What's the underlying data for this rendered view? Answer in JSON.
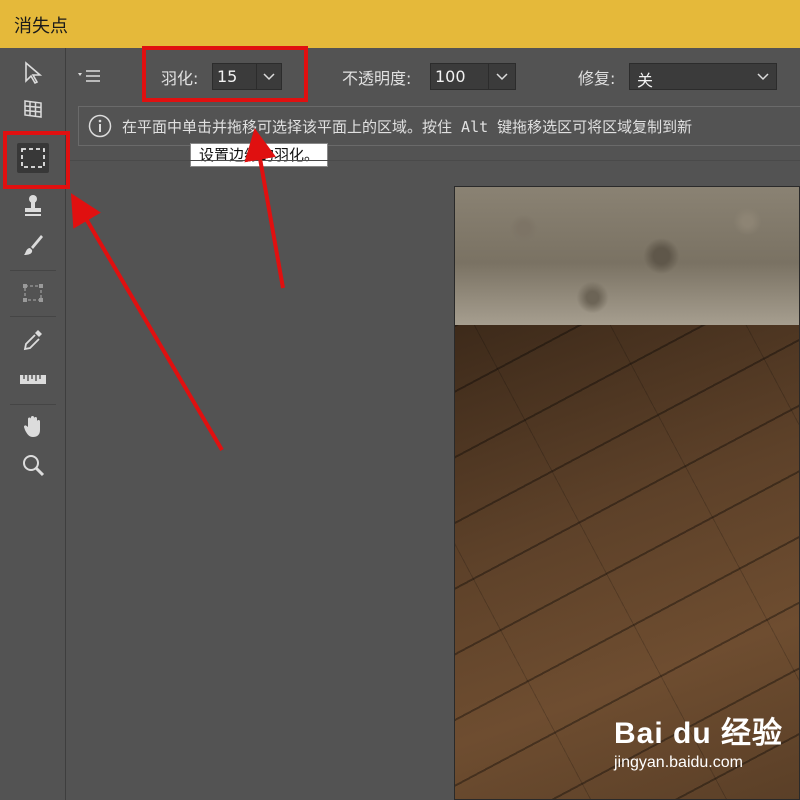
{
  "window": {
    "title": "消失点"
  },
  "options": {
    "feather_label": "羽化:",
    "feather_value": "15",
    "opacity_label": "不透明度:",
    "opacity_value": "100",
    "heal_label": "修复:",
    "heal_value": "关"
  },
  "info": {
    "message": "在平面中单击并拖移可选择该平面上的区域。按住 Alt 键拖移选区可将区域复制到新",
    "tooltip": "设置边缘的羽化。"
  },
  "toolbar": {
    "tools": [
      {
        "name": "edit-plane-tool",
        "icon": "arrow-icon"
      },
      {
        "name": "create-plane-tool",
        "icon": "grid-icon"
      },
      {
        "name": "marquee-tool",
        "icon": "marquee-icon",
        "active": true
      },
      {
        "name": "stamp-tool",
        "icon": "stamp-icon"
      },
      {
        "name": "brush-tool",
        "icon": "brush-icon"
      },
      {
        "name": "transform-tool",
        "icon": "transform-icon"
      },
      {
        "name": "eyedropper-tool",
        "icon": "eyedropper-icon"
      },
      {
        "name": "measure-tool",
        "icon": "ruler-icon"
      },
      {
        "name": "hand-tool",
        "icon": "hand-icon"
      },
      {
        "name": "zoom-tool",
        "icon": "zoom-icon"
      }
    ]
  },
  "watermark": {
    "logo": "Bai du 经验",
    "url": "jingyan.baidu.com"
  },
  "colors": {
    "titlebar": "#e5b93a",
    "panel": "#535353",
    "highlight": "#e01010"
  }
}
